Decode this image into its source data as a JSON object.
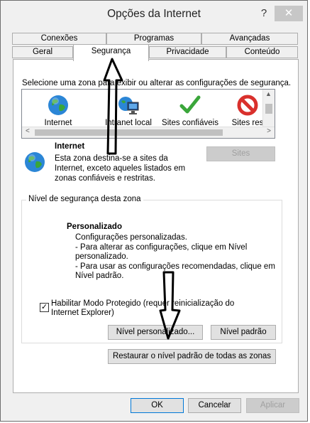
{
  "window": {
    "title": "Opções da Internet",
    "help_label": "?",
    "close_label": "✕"
  },
  "tabs": {
    "row1": [
      {
        "label": "Conexões"
      },
      {
        "label": "Programas"
      },
      {
        "label": "Avançadas"
      }
    ],
    "row2": [
      {
        "label": "Geral"
      },
      {
        "label": "Segurança"
      },
      {
        "label": "Privacidade"
      },
      {
        "label": "Conteúdo"
      }
    ]
  },
  "security": {
    "instruction": "Selecione uma zona para exibir ou alterar as configurações de segurança.",
    "zones": [
      {
        "label": "Internet",
        "icon": "globe-icon"
      },
      {
        "label": "Intranet local",
        "icon": "intranet-icon"
      },
      {
        "label": "Sites confiáveis",
        "icon": "checkmark-icon"
      },
      {
        "label": "Sites res",
        "icon": "restricted-icon"
      }
    ],
    "selected_zone_title": "Internet",
    "selected_zone_desc_1": "Esta zona destina-se a sites da",
    "selected_zone_desc_2": "Internet, exceto aqueles listados em",
    "selected_zone_desc_3": "zonas confiáveis e restritas.",
    "sites_button": "Sites",
    "level_group_label": "Nível de segurança desta zona",
    "level_title": "Personalizado",
    "level_line_1": "Configurações personalizadas.",
    "level_line_2": "- Para alterar as configurações, clique em Nível",
    "level_line_3": "personalizado.",
    "level_line_4": "- Para usar as configurações recomendadas, clique em",
    "level_line_5": "Nível padrão.",
    "protected_mode_label_1": "Habilitar Modo Protegido (requer reinicialização do",
    "protected_mode_label_2": "Internet Explorer)",
    "protected_mode_checked": true,
    "custom_level_button": "Nível personalizado...",
    "default_level_button": "Nível padrão",
    "reset_all_button": "Restaurar o nível padrão de todas as zonas"
  },
  "footer": {
    "ok": "OK",
    "cancel": "Cancelar",
    "apply": "Aplicar"
  },
  "colors": {
    "accent": "#0078d7",
    "close_bg": "#c7c7c7",
    "checkmark": "#3aa63a",
    "restricted": "#d9302c"
  }
}
